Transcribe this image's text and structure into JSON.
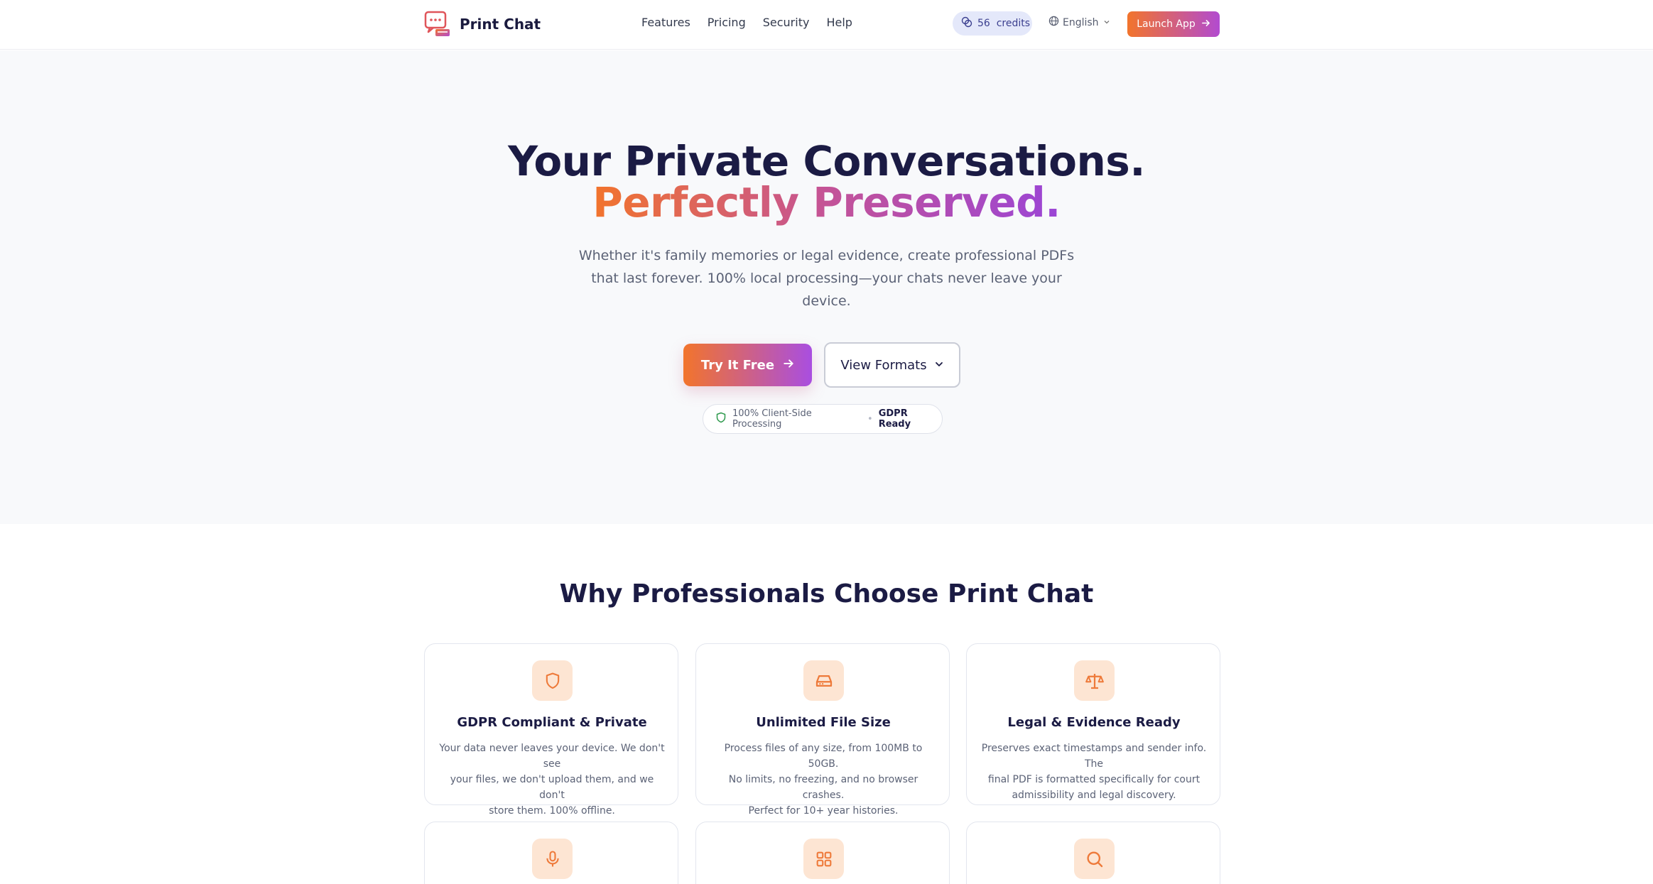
{
  "header": {
    "logo_text": "Print Chat",
    "nav": [
      "Features",
      "Pricing",
      "Security",
      "Help"
    ],
    "credits_label": "56  credits",
    "language": "English",
    "launch_label": "Launch App"
  },
  "hero": {
    "title_line1": "Your Private Conversations.",
    "title_line2": "Perfectly Preserved.",
    "subtitle_lines": [
      "Whether it's family memories or legal evidence, create professional PDFs",
      "that last forever. 100% local processing—your chats never leave your",
      "device."
    ],
    "primary_cta": "Try It Free",
    "secondary_cta": "View Formats",
    "trust_text": "100% Client-Side Processing",
    "trust_badge": "GDPR Ready"
  },
  "why": {
    "title": "Why Professionals Choose Print Chat",
    "features": [
      {
        "icon": "shield-icon",
        "title": "GDPR Compliant & Private",
        "text_lines": [
          "Your data never leaves your device. We don't see",
          "your files, we don't upload them, and we don't",
          "store them. 100% offline."
        ]
      },
      {
        "icon": "hard-drive-icon",
        "title": "Unlimited File Size",
        "text_lines": [
          "Process files of any size, from 100MB to 50GB.",
          "No limits, no freezing, and no browser crashes.",
          "Perfect for 10+ year histories."
        ]
      },
      {
        "icon": "scale-icon",
        "title": "Legal & Evidence Ready",
        "text_lines": [
          "Preserves exact timestamps and sender info. The",
          "final PDF is formatted specifically for court",
          "admissibility and legal discovery."
        ]
      },
      {
        "icon": "microphone-icon"
      },
      {
        "icon": "grid-icon"
      },
      {
        "icon": "search-icon"
      }
    ]
  },
  "colors": {
    "brand_orange": "#f2742c",
    "brand_purple": "#9b45d6",
    "text_dark": "#1b1b44",
    "hero_bg": "#f8f9fb",
    "icon_bg": "#fde5d3"
  }
}
